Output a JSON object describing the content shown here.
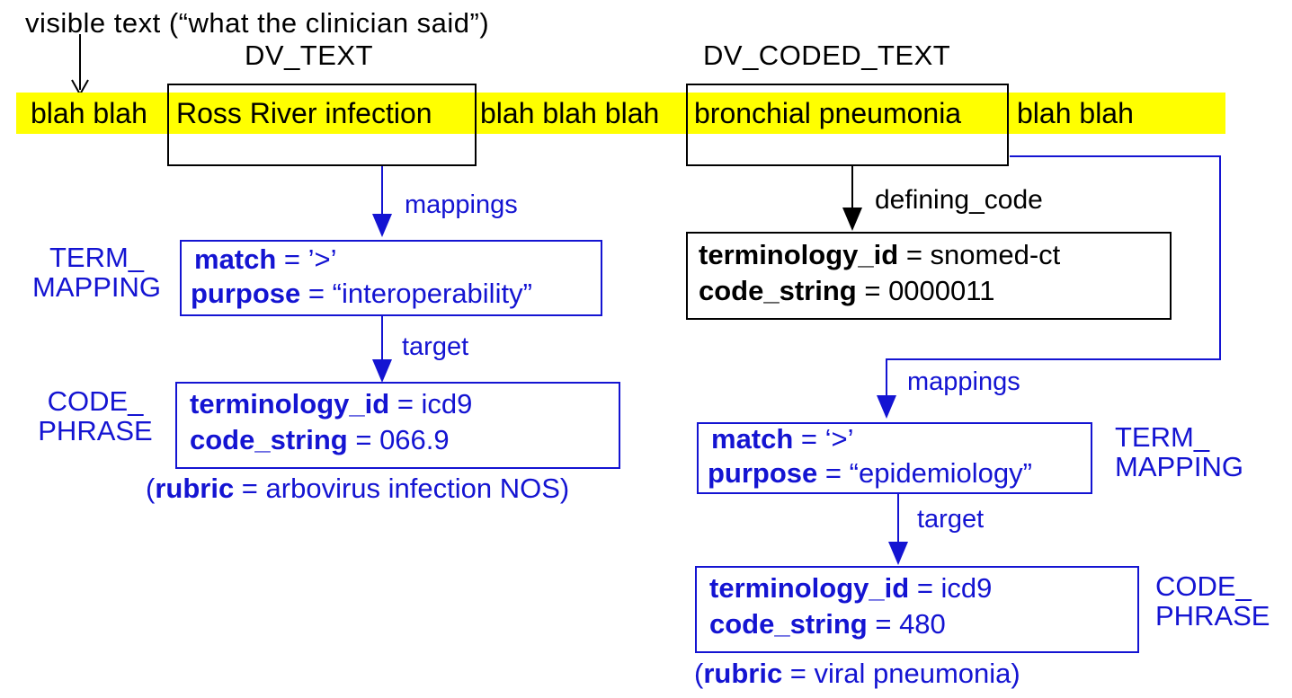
{
  "figure": {
    "annotation_top": "visible text (“what the clinician said”)",
    "caption_left": "DV_TEXT",
    "caption_right": "DV_CODED_TEXT"
  },
  "narrative": {
    "segment_before": "blah blah",
    "highlighted_text_left": "Ross River infection",
    "segment_middle": "blah blah blah",
    "highlighted_text_right": "bronchial pneumonia",
    "segment_after": "blah blah"
  },
  "class_labels": {
    "term_mapping_left": "TERM_\nMAPPING",
    "term_mapping_left_line1": "TERM_",
    "term_mapping_left_line2": "MAPPING",
    "code_phrase_left_line1": "CODE_",
    "code_phrase_left_line2": "PHRASE",
    "term_mapping_right_line1": "TERM_",
    "term_mapping_right_line2": "MAPPING",
    "code_phrase_right_line1": "CODE_",
    "code_phrase_right_line2": "PHRASE"
  },
  "edges": {
    "mappings_left": "mappings",
    "target_left": "target",
    "defining_code": "defining_code",
    "mappings_right": "mappings",
    "target_right": "target"
  },
  "nodes": {
    "term_mapping_left": {
      "attr1_name": "match",
      "attr1_eq": " = ",
      "attr1_value": "’>’",
      "attr2_name": "purpose",
      "attr2_eq": " = ",
      "attr2_value": "“interoperability”"
    },
    "code_phrase_left": {
      "attr1_name": "terminology_id",
      "attr1_eq": " = ",
      "attr1_value": " icd9",
      "attr2_name": "code_string",
      "attr2_eq": " = ",
      "attr2_value": "066.9",
      "rubric_open": "(",
      "rubric_name": "rubric",
      "rubric_eq": " = ",
      "rubric_value": "arbovirus infection NOS)"
    },
    "defining_code_right": {
      "attr1_name": "terminology_id",
      "attr1_eq": " = ",
      "attr1_value": " snomed-ct",
      "attr2_name": "code_string",
      "attr2_eq": " = ",
      "attr2_value": "0000011"
    },
    "term_mapping_right": {
      "attr1_name": "match",
      "attr1_eq": " = ",
      "attr1_value": "‘>’",
      "attr2_name": "purpose",
      "attr2_eq": " = ",
      "attr2_value": "“epidemiology”"
    },
    "code_phrase_right": {
      "attr1_name": "terminology_id",
      "attr1_eq": " = ",
      "attr1_value": " icd9",
      "attr2_name": "code_string",
      "attr2_eq": " = ",
      "attr2_value": "480",
      "rubric_open": "(",
      "rubric_name": "rubric",
      "rubric_eq": " = ",
      "rubric_value": "viral pneumonia)"
    }
  },
  "colors": {
    "highlight": "#ffff00",
    "blue": "#1414d2",
    "black": "#000000",
    "background": "#ffffff"
  }
}
